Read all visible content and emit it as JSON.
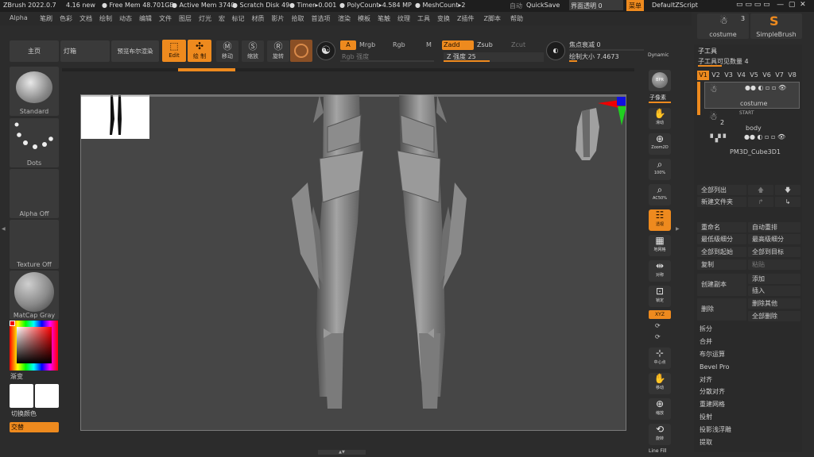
{
  "topbar": {
    "app": "ZBrush 2022.0.7",
    "version": "4.16 new",
    "free_mem": "Free Mem 48.701GB",
    "active_mem": "Active Mem 3740",
    "scratch": "Scratch Disk 49",
    "timer": "Timer▸0.001",
    "polycount": "PolyCount▸4.584 MP",
    "meshcount": "MeshCount▸2",
    "auto": "自动",
    "quicksave": "QuickSave",
    "transparency": "界面透明 0",
    "menu_btn": "菜单",
    "script": "DefaultZScript"
  },
  "menubar": [
    "Alpha",
    "笔刷",
    "色彩",
    "文档",
    "绘制",
    "动态",
    "编辑",
    "文件",
    "图层",
    "灯光",
    "宏",
    "标记",
    "材质",
    "影片",
    "拾取",
    "首选项",
    "渲染",
    "模板",
    "笔触",
    "纹理",
    "工具",
    "变换",
    "Z插件",
    "Z脚本",
    "帮助"
  ],
  "toolbar": {
    "home": "主页",
    "lightbox": "灯箱",
    "bpr": "预览布尔渲染",
    "edit": "Edit",
    "draw": "绘 制",
    "move": "移动",
    "scale": "缩放",
    "rotate": "旋转",
    "a": "A",
    "mrgb": "Mrgb",
    "rgb": "Rgb",
    "m": "M",
    "rgb_intensity": "Rgb 强度",
    "zadd": "Zadd",
    "zsub": "Zsub",
    "zcut": "Zcut",
    "z_intensity": "Z 强度 25",
    "focal": "焦点衰减 0",
    "draw_size": "绘制大小 7.4673",
    "dynamic": "Dynamic"
  },
  "left": {
    "brush": "Standard",
    "stroke": "Dots",
    "alpha": "Alpha Off",
    "texture": "Texture Off",
    "material": "MatCap Gray",
    "gradient": "渐变",
    "switch_color": "切换颜色",
    "alternate": "交替",
    "colors": {
      "main": "#ffffff",
      "secondary": "#ffffff",
      "accent": "#ee8a1e"
    }
  },
  "shelf": {
    "bpr": "BPR",
    "subpixel": "子像素",
    "scroll": "滑动",
    "zoom2d": "Zoom2D",
    "p100": "100%",
    "ac50": "AC50%",
    "persp": "透视",
    "floor": "地网格",
    "symmetry": "对称",
    "lock": "锁定",
    "xyz": "XYZ",
    "center": "中心点",
    "move": "移动",
    "zoom": "缩放",
    "rotate": "旋转",
    "linefill": "Line Fill"
  },
  "right": {
    "costume_label": "costume",
    "costume_count": "3",
    "simplebrush": "SimpleBrush",
    "subtool_title": "子工具",
    "visible_count": "子工具可见数量 4",
    "versions": [
      "V1",
      "V2",
      "V3",
      "V4",
      "V5",
      "V6",
      "V7",
      "V8"
    ],
    "subtools": [
      "costume",
      "body",
      "PM3D_Cube3D1"
    ],
    "start": "START",
    "body_count": "2",
    "list_all": "全部列出",
    "new_folder": "新建文件夹",
    "rename": "重命名",
    "auto_reorder": "自动重排",
    "lowest_sub": "最低级细分",
    "highest_sub": "最高级细分",
    "all_to_start": "全部到起始",
    "all_to_target": "全部到目标",
    "copy": "复制",
    "paste": "粘贴",
    "create_copy": "创建副本",
    "add": "添加",
    "insert": "插入",
    "delete": "删除",
    "delete_others": "删除其他",
    "delete_all": "全部删除",
    "split": "拆分",
    "merge": "合并",
    "boolean": "布尔运算",
    "bevel_pro": "Bevel Pro",
    "align": "对齐",
    "distribute": "分散对齐",
    "remesh": "重建网格",
    "project": "投射",
    "project_bas": "投影浅浮雕",
    "extract": "提取"
  }
}
